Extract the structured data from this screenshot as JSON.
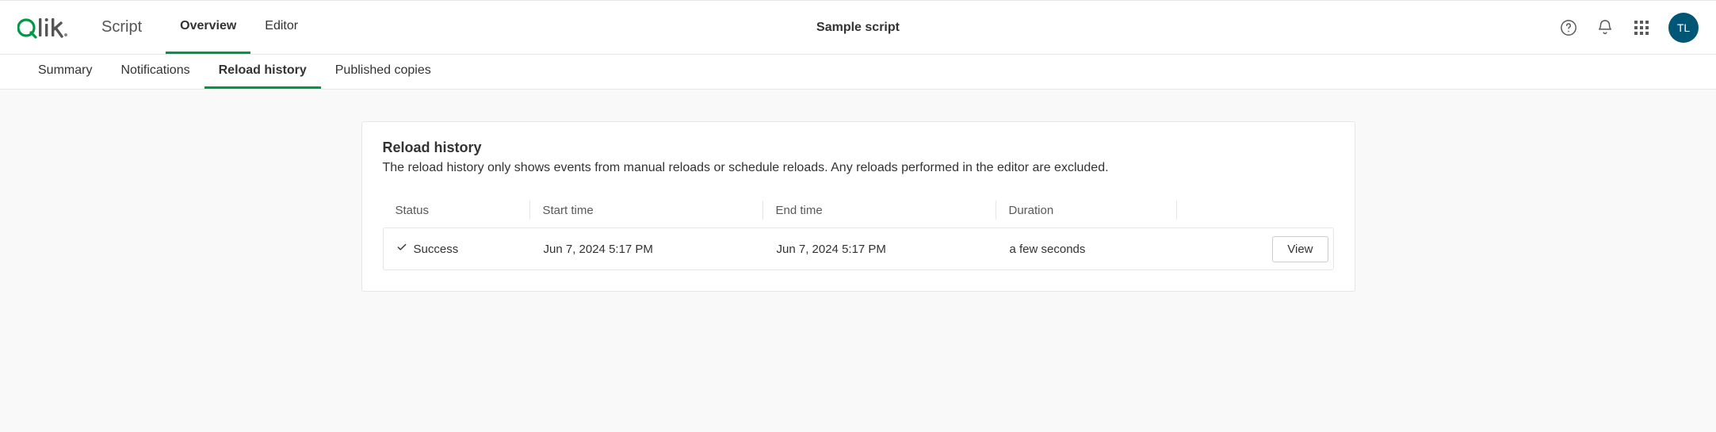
{
  "header": {
    "app_label": "Script",
    "tabs": [
      {
        "label": "Overview",
        "active": true
      },
      {
        "label": "Editor",
        "active": false
      }
    ],
    "title": "Sample script",
    "avatar_initials": "TL"
  },
  "subnav": {
    "tabs": [
      {
        "label": "Summary",
        "active": false
      },
      {
        "label": "Notifications",
        "active": false
      },
      {
        "label": "Reload history",
        "active": true
      },
      {
        "label": "Published copies",
        "active": false
      }
    ]
  },
  "card": {
    "title": "Reload history",
    "description": "The reload history only shows events from manual reloads or schedule reloads. Any reloads performed in the editor are excluded."
  },
  "table": {
    "headers": {
      "status": "Status",
      "start": "Start time",
      "end": "End time",
      "duration": "Duration"
    },
    "rows": [
      {
        "status": "Success",
        "start": "Jun 7, 2024 5:17 PM",
        "end": "Jun 7, 2024 5:17 PM",
        "duration": "a few seconds",
        "action_label": "View"
      }
    ]
  }
}
